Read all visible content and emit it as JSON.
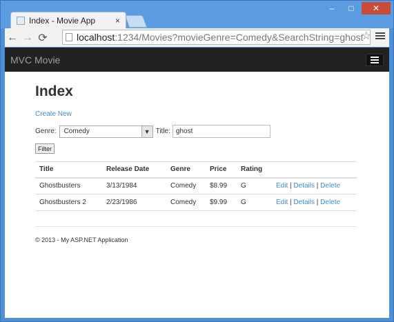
{
  "browser": {
    "tab_title": "Index - Movie App",
    "tab_close": "×",
    "url_host": "localhost",
    "url_rest": ":1234/Movies?movieGenre=Comedy&SearchString=ghost",
    "window_buttons": {
      "minimize": "‒",
      "maximize": "□",
      "close": "✕"
    },
    "nav": {
      "back": "←",
      "forward": "→",
      "reload": "⟳",
      "star": "☆"
    }
  },
  "navbar": {
    "brand": "MVC Movie"
  },
  "page": {
    "title": "Index",
    "create_new": "Create New",
    "genre_label": "Genre:",
    "genre_selected": "Comedy",
    "title_label": "Title:",
    "search_value": "ghost",
    "filter_button": "Filter"
  },
  "table": {
    "headers": [
      "Title",
      "Release Date",
      "Genre",
      "Price",
      "Rating",
      ""
    ],
    "rows": [
      {
        "title": "Ghostbusters",
        "release_date": "3/13/1984",
        "genre": "Comedy",
        "price": "$8.99",
        "rating": "G",
        "edit": "Edit",
        "details": "Details",
        "delete": "Delete"
      },
      {
        "title": "Ghostbusters 2",
        "release_date": "2/23/1986",
        "genre": "Comedy",
        "price": "$9.99",
        "rating": "G",
        "edit": "Edit",
        "details": "Details",
        "delete": "Delete"
      }
    ],
    "separator": "|"
  },
  "footer": {
    "text": "© 2013 - My ASP.NET Application"
  },
  "colors": {
    "link": "#428bca",
    "navbar": "#222222",
    "frame": "#4f8fd6"
  },
  "icons": {
    "menu": "hamburger-icon",
    "dropdown": "chevron-down-icon"
  }
}
